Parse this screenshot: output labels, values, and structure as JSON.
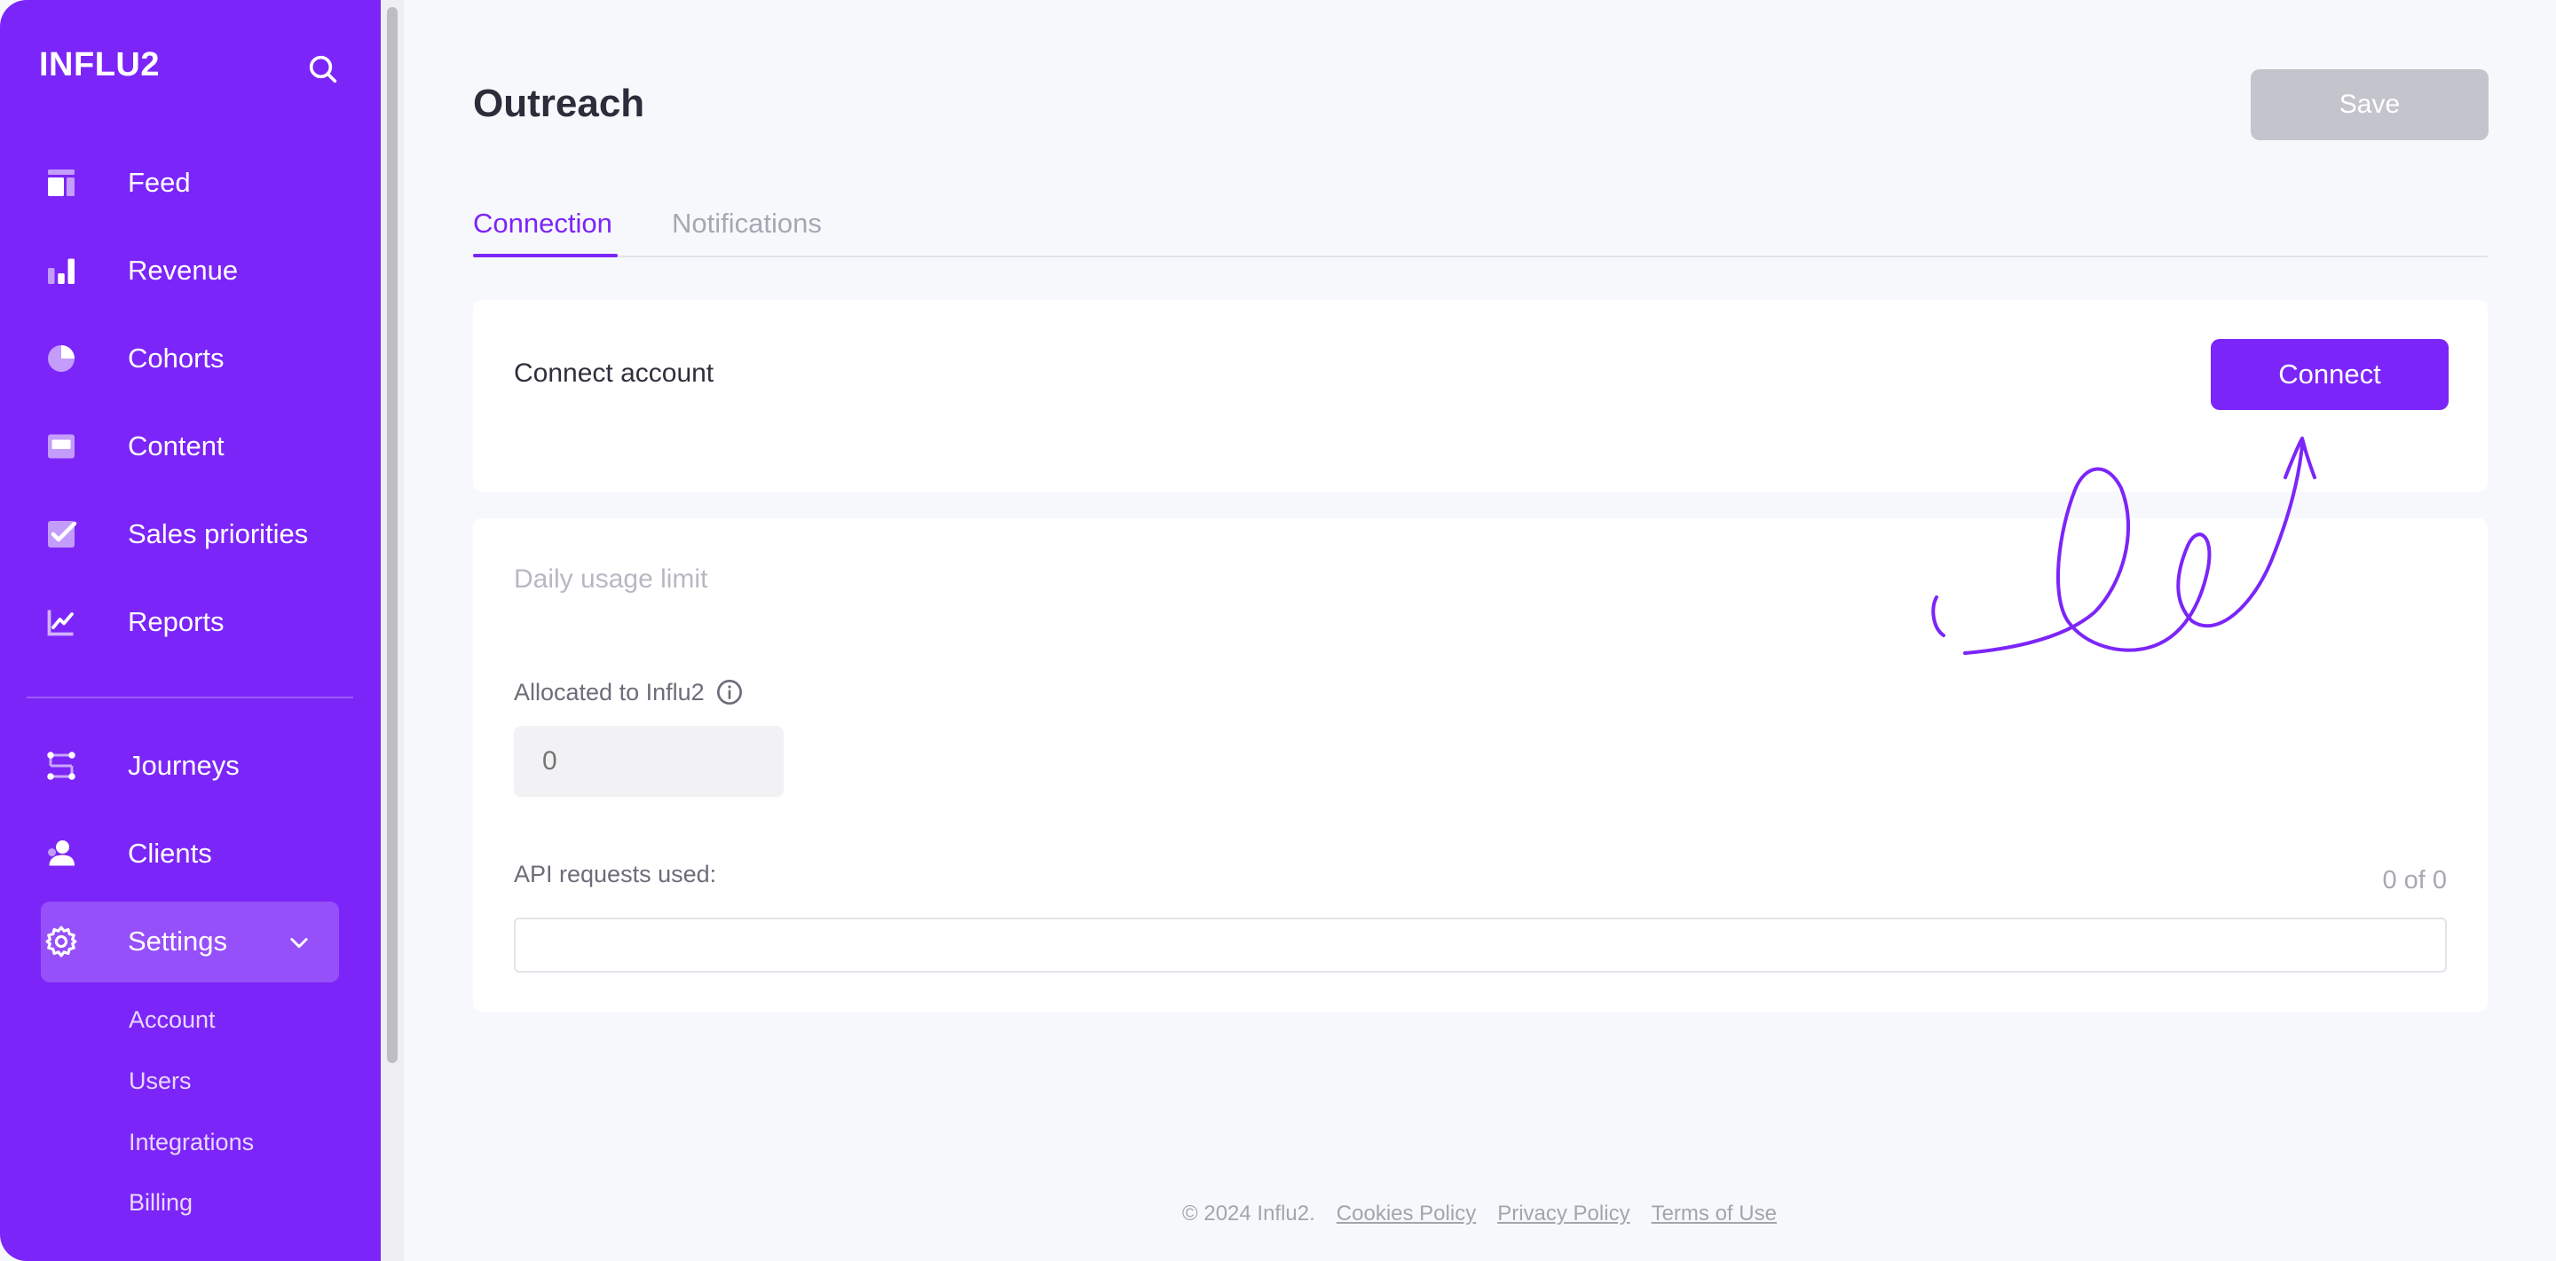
{
  "app": {
    "brand": "INFLU2"
  },
  "sidebar": {
    "items": [
      {
        "label": "Feed",
        "icon": "feed-icon"
      },
      {
        "label": "Revenue",
        "icon": "bar-chart-icon"
      },
      {
        "label": "Cohorts",
        "icon": "pie-chart-icon"
      },
      {
        "label": "Content",
        "icon": "content-icon"
      },
      {
        "label": "Sales priorities",
        "icon": "checkbox-icon"
      },
      {
        "label": "Reports",
        "icon": "line-chart-icon"
      }
    ],
    "items2": [
      {
        "label": "Journeys",
        "icon": "journeys-icon"
      },
      {
        "label": "Clients",
        "icon": "user-icon"
      },
      {
        "label": "Settings",
        "icon": "gear-icon",
        "active": true
      }
    ],
    "settings_sub": [
      "Account",
      "Users",
      "Integrations",
      "Billing"
    ]
  },
  "header": {
    "title": "Outreach",
    "save_label": "Save"
  },
  "tabs": [
    {
      "label": "Connection",
      "active": true
    },
    {
      "label": "Notifications",
      "active": false
    }
  ],
  "connection": {
    "label": "Connect account",
    "button": "Connect"
  },
  "usage": {
    "title": "Daily usage limit",
    "allocated_label": "Allocated to Influ2",
    "allocated_placeholder": "0",
    "api_label": "API requests used:",
    "api_count": "0 of 0",
    "progress": 0
  },
  "footer": {
    "copyright": "© 2024 Influ2.",
    "links": [
      "Cookies Policy",
      "Privacy Policy",
      "Terms of Use"
    ]
  },
  "colors": {
    "accent": "#7c25f8",
    "save_disabled": "#c4c4cc",
    "background": "#f7f8fc"
  }
}
